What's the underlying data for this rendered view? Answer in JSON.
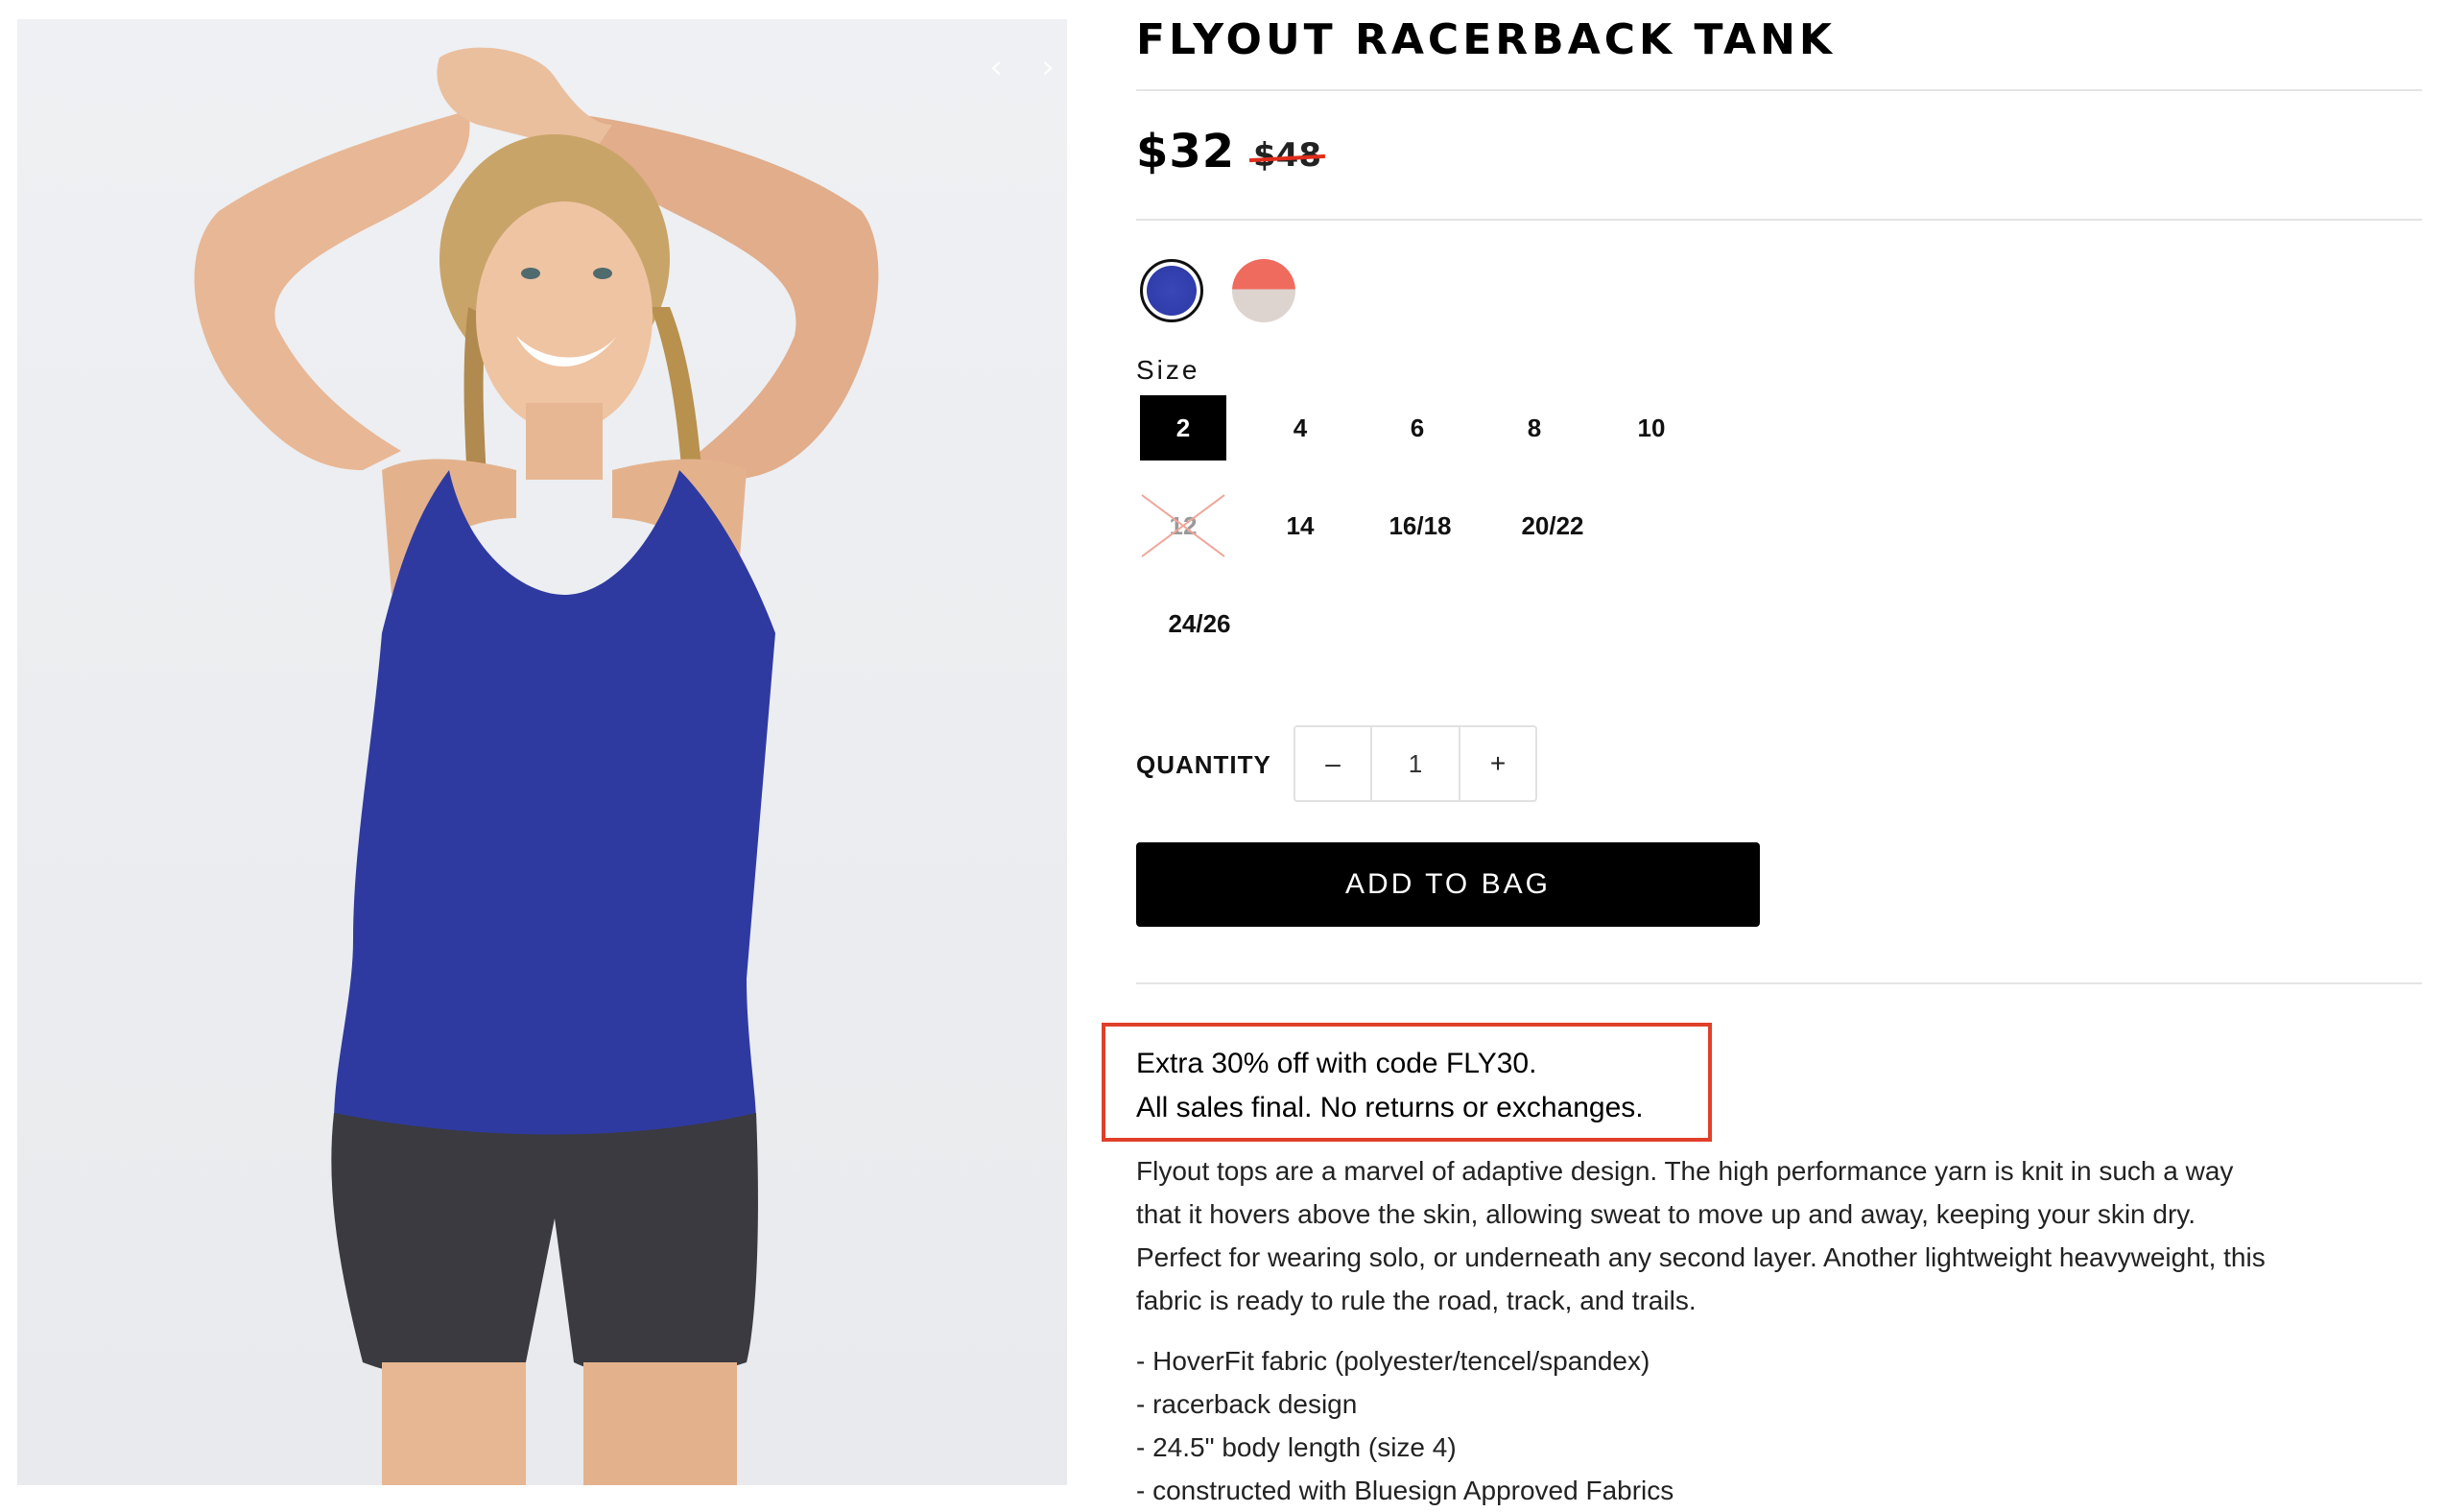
{
  "gallery": {
    "prev_icon": "‹",
    "next_icon": "›"
  },
  "product": {
    "title": "FLYOUT RACERBACK TANK",
    "price": "$32",
    "original_price": "$48",
    "swatches": [
      {
        "name": "navy",
        "color": "#3a47b8",
        "selected": true
      },
      {
        "name": "coral",
        "color_top": "#ef6b5d",
        "color_bottom": "#ddd4cf",
        "selected": false
      }
    ],
    "size_label": "Size",
    "sizes": [
      {
        "label": "2",
        "selected": true,
        "available": true
      },
      {
        "label": "4",
        "available": true
      },
      {
        "label": "6",
        "available": true
      },
      {
        "label": "8",
        "available": true
      },
      {
        "label": "10",
        "available": true
      },
      {
        "label": "12",
        "available": false
      },
      {
        "label": "14",
        "available": true
      },
      {
        "label": "16/18",
        "available": true
      },
      {
        "label": "20/22",
        "available": true
      },
      {
        "label": "24/26",
        "available": true
      }
    ],
    "quantity_label": "QUANTITY",
    "quantity_value": "1",
    "decrement_symbol": "–",
    "increment_symbol": "+",
    "add_to_bag_label": "ADD TO BAG",
    "promo_lines": [
      "Extra 30% off with code FLY30.",
      "All sales final. No returns or exchanges."
    ],
    "description_lines": [
      "Flyout tops are a marvel of adaptive design. The high performance yarn is knit in such a way",
      "that it hovers above the skin, allowing sweat to move up and away, keeping your skin dry.",
      "Perfect for wearing solo, or underneath any second layer. Another lightweight heavyweight, this",
      "fabric is ready to rule the road, track, and trails."
    ],
    "features": [
      "- HoverFit fabric (polyester/tencel/spandex)",
      "- racerback design",
      "- 24.5\" body length (size 4)",
      "- constructed with Bluesign Approved Fabrics"
    ]
  },
  "colors": {
    "accent_red": "#e0402a",
    "tank_blue": "#2f3aa0",
    "shorts_gray": "#3a3a40"
  }
}
